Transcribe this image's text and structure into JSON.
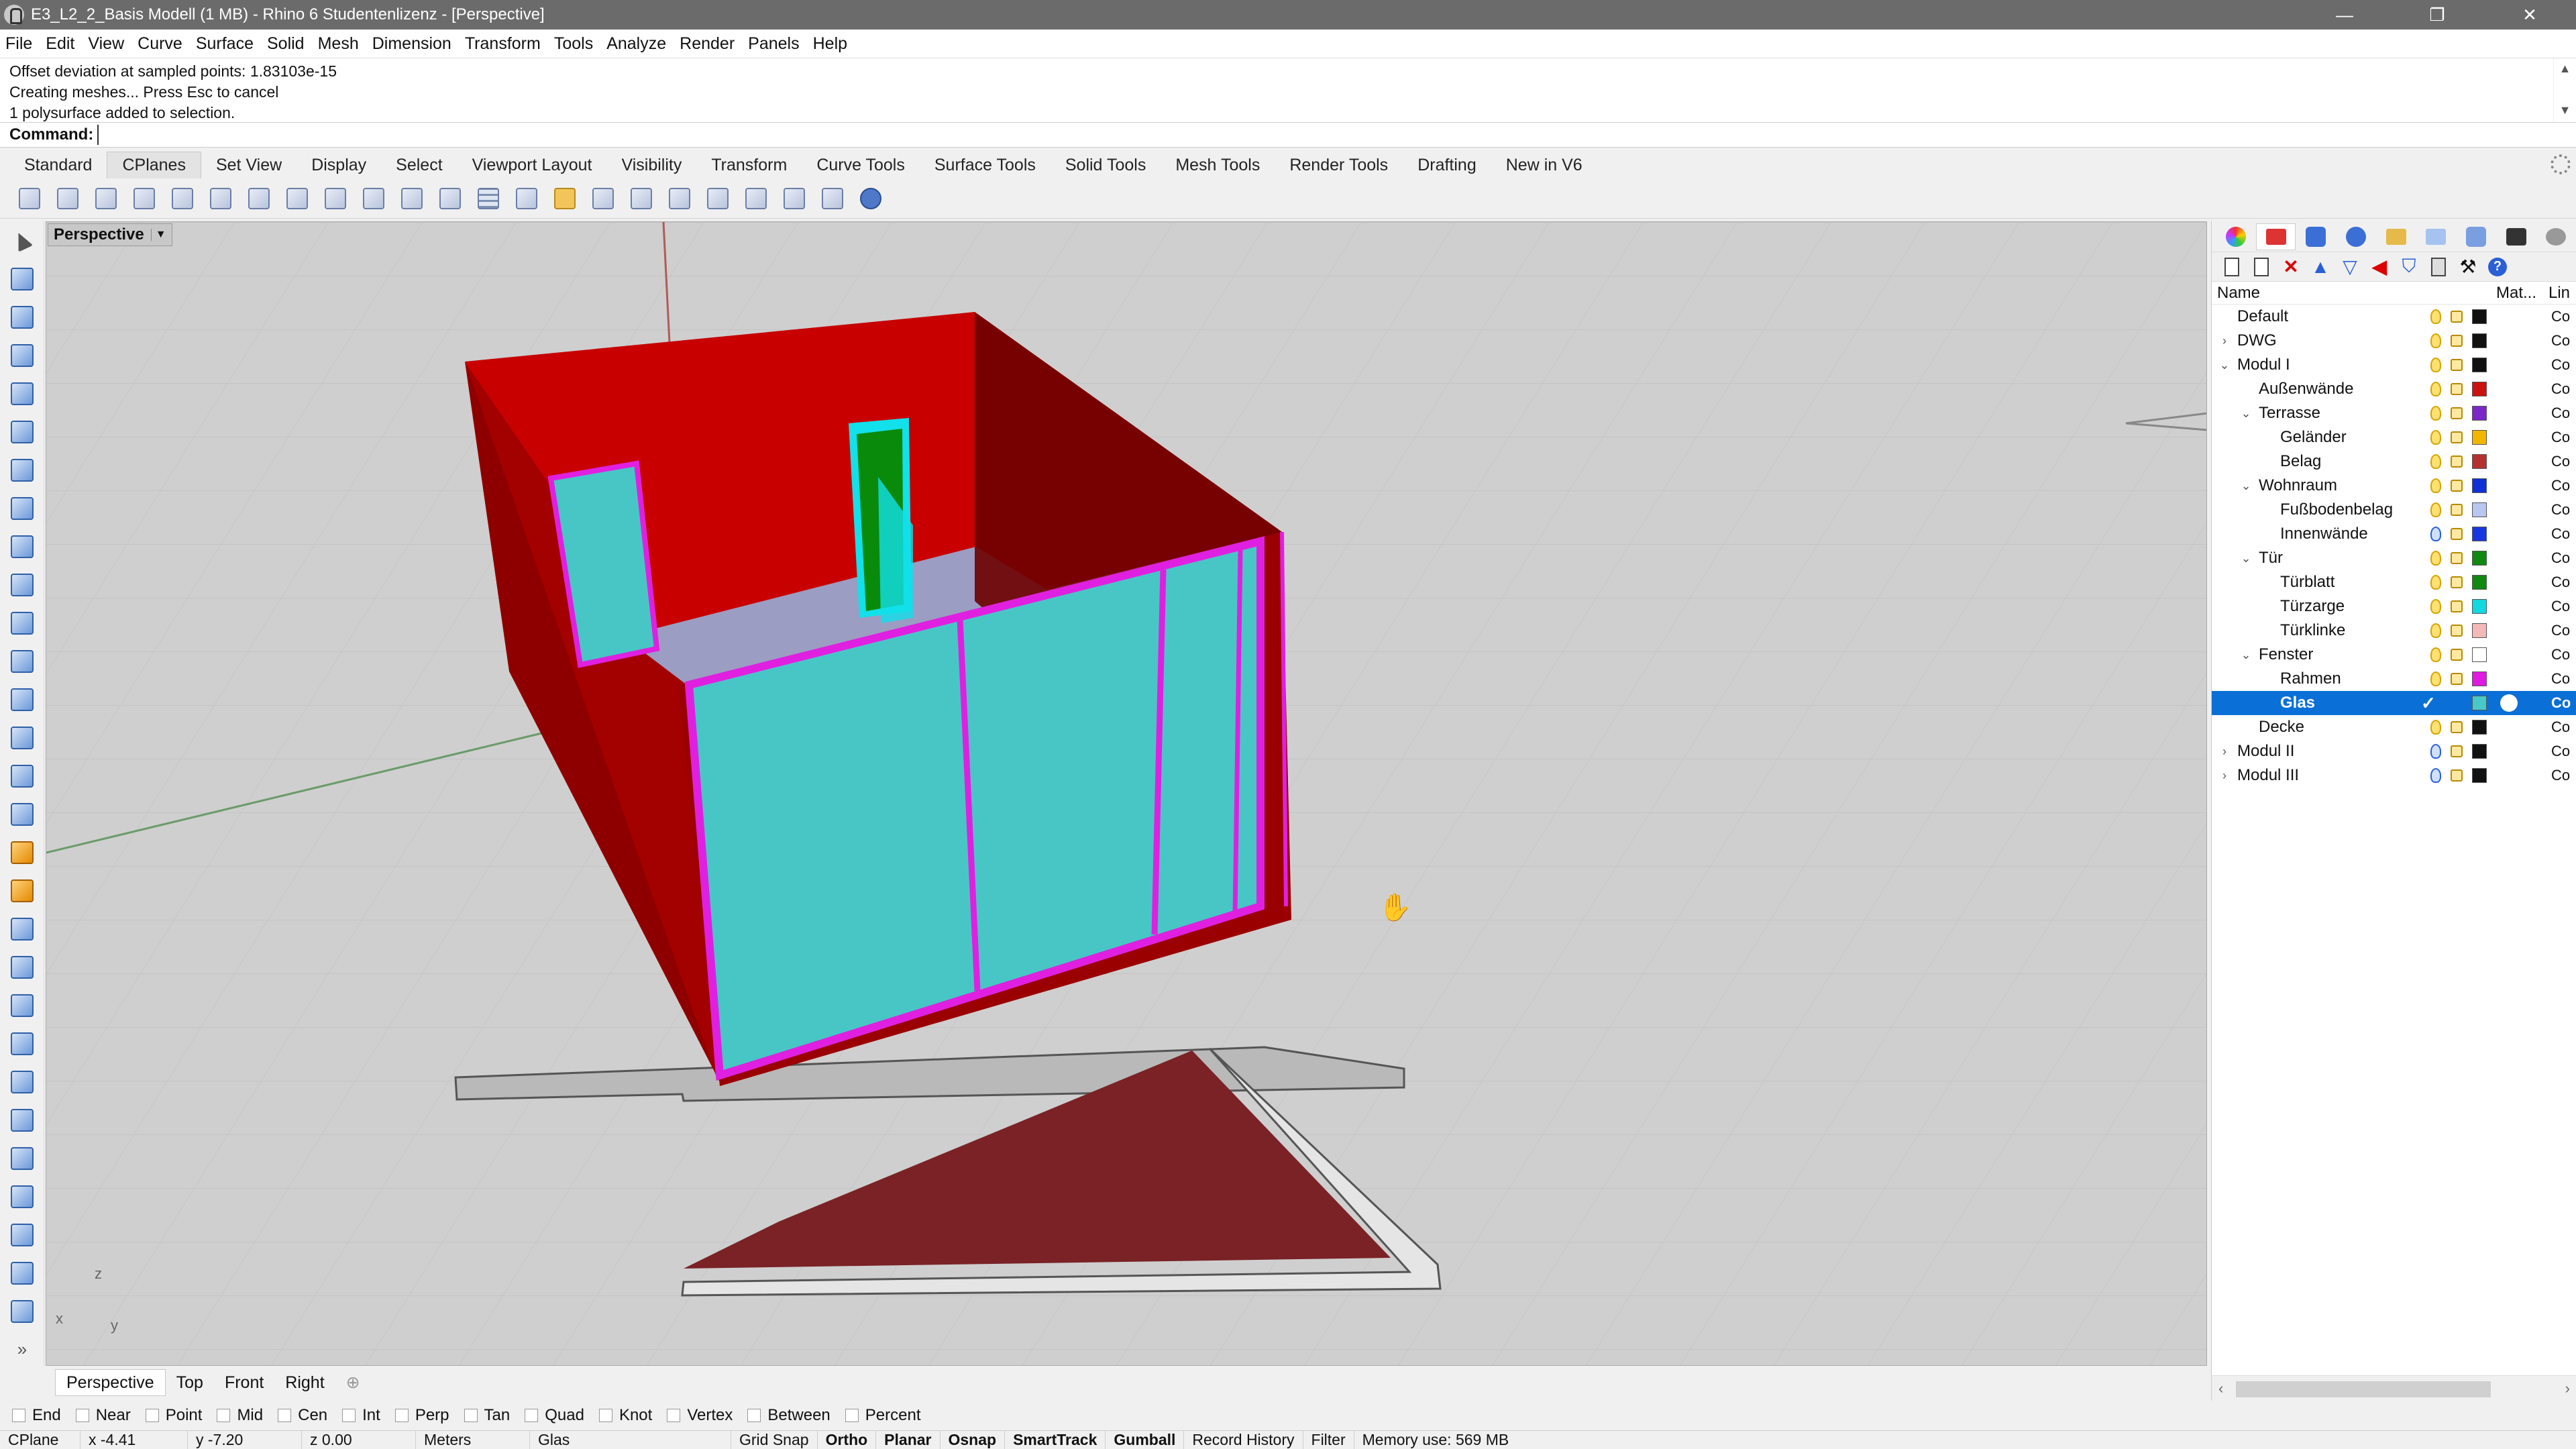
{
  "window": {
    "title": "E3_L2_2_Basis Modell (1 MB) - Rhino 6 Studentenlizenz - [Perspective]",
    "minimize": "—",
    "restore": "❐",
    "close": "✕"
  },
  "menu": [
    "File",
    "Edit",
    "View",
    "Curve",
    "Surface",
    "Solid",
    "Mesh",
    "Dimension",
    "Transform",
    "Tools",
    "Analyze",
    "Render",
    "Panels",
    "Help"
  ],
  "command_history": [
    "Offset deviation at sampled points: 1.83103e-15",
    "Creating meshes... Press Esc to cancel",
    "1 polysurface added to selection."
  ],
  "command": {
    "label": "Command:",
    "value": ""
  },
  "toolbar_tabs": [
    "Standard",
    "CPlanes",
    "Set View",
    "Display",
    "Select",
    "Viewport Layout",
    "Visibility",
    "Transform",
    "Curve Tools",
    "Surface Tools",
    "Solid Tools",
    "Mesh Tools",
    "Render Tools",
    "Drafting",
    "New in V6"
  ],
  "active_toolbar_tab": "CPlanes",
  "cplane_tools": [
    "cplane-world-top-icon",
    "cplane-world-front-icon",
    "cplane-world-right-icon",
    "cplane-origin-icon",
    "cplane-elevation-icon",
    "cplane-z-axis-icon",
    "cplane-3-point-icon",
    "cplane-x-axis-icon",
    "cplane-to-object-icon",
    "cplane-perpendicular-icon",
    "cplane-previous-icon",
    "cplane-next-icon",
    "grid-options-icon",
    "named-cplanes-icon",
    "open-cplane-icon",
    "set-cplane-view-icon",
    "cplane-to-curve-icon",
    "cplane-rotate-icon",
    "cplane-surface-icon",
    "cplane-3d-icon",
    "cplane-undo-icon",
    "cplane-redo-icon",
    "cplane-object-icon"
  ],
  "viewport": {
    "name": "Perspective",
    "axis_z": "z",
    "axis_x": "x",
    "axis_y": "y"
  },
  "viewport_tabs": [
    "Perspective",
    "Top",
    "Front",
    "Right"
  ],
  "osnaps": [
    "End",
    "Near",
    "Point",
    "Mid",
    "Cen",
    "Int",
    "Perp",
    "Tan",
    "Quad",
    "Knot",
    "Vertex",
    "Between",
    "Percent"
  ],
  "status": {
    "cplane": "CPlane",
    "x": "x -4.41",
    "y": "y -7.20",
    "z": "z 0.00",
    "units": "Meters",
    "layer": "Glas",
    "grid_snap": "Grid Snap",
    "ortho": "Ortho",
    "planar": "Planar",
    "osnap": "Osnap",
    "smarttrack": "SmartTrack",
    "gumball": "Gumball",
    "record_history": "Record History",
    "filter": "Filter",
    "memory": "Memory use: 569 MB"
  },
  "layers_panel": {
    "header_name": "Name",
    "header_material": "Mat...",
    "header_linetype": "Lin",
    "rows": [
      {
        "name": "Default",
        "indent": 0,
        "expander": "",
        "color": "#111111",
        "linetype": "Co",
        "bulb": "on"
      },
      {
        "name": "DWG",
        "indent": 0,
        "expander": "›",
        "color": "#111111",
        "linetype": "Co",
        "bulb": "on"
      },
      {
        "name": "Modul I",
        "indent": 0,
        "expander": "⌄",
        "color": "#111111",
        "linetype": "Co",
        "bulb": "on"
      },
      {
        "name": "Außenwände",
        "indent": 1,
        "expander": "",
        "color": "#cc1111",
        "linetype": "Co",
        "bulb": "on"
      },
      {
        "name": "Terrasse",
        "indent": 1,
        "expander": "⌄",
        "color": "#7a28c8",
        "linetype": "Co",
        "bulb": "on"
      },
      {
        "name": "Geländer",
        "indent": 2,
        "expander": "",
        "color": "#f2b600",
        "linetype": "Co",
        "bulb": "on"
      },
      {
        "name": "Belag",
        "indent": 2,
        "expander": "",
        "color": "#b53030",
        "linetype": "Co",
        "bulb": "on"
      },
      {
        "name": "Wohnraum",
        "indent": 1,
        "expander": "⌄",
        "color": "#1030d8",
        "linetype": "Co",
        "bulb": "on"
      },
      {
        "name": "Fußbodenbelag",
        "indent": 2,
        "expander": "",
        "color": "#b9c6f0",
        "linetype": "Co",
        "bulb": "on"
      },
      {
        "name": "Innenwände",
        "indent": 2,
        "expander": "",
        "color": "#1a36e0",
        "linetype": "Co",
        "bulb": "off"
      },
      {
        "name": "Tür",
        "indent": 1,
        "expander": "⌄",
        "color": "#118811",
        "linetype": "Co",
        "bulb": "on"
      },
      {
        "name": "Türblatt",
        "indent": 2,
        "expander": "",
        "color": "#118811",
        "linetype": "Co",
        "bulb": "on"
      },
      {
        "name": "Türzarge",
        "indent": 2,
        "expander": "",
        "color": "#12d8e0",
        "linetype": "Co",
        "bulb": "on"
      },
      {
        "name": "Türklinke",
        "indent": 2,
        "expander": "",
        "color": "#f2b9b9",
        "linetype": "Co",
        "bulb": "on"
      },
      {
        "name": "Fenster",
        "indent": 1,
        "expander": "⌄",
        "color": "#ffffff",
        "linetype": "Co",
        "bulb": "on"
      },
      {
        "name": "Rahmen",
        "indent": 2,
        "expander": "",
        "color": "#e01ae0",
        "linetype": "Co",
        "bulb": "on"
      },
      {
        "name": "Glas",
        "indent": 2,
        "expander": "",
        "color": "#48c8c8",
        "linetype": "Co",
        "bulb": "current",
        "selected": true
      },
      {
        "name": "Decke",
        "indent": 1,
        "expander": "",
        "color": "#111111",
        "linetype": "Co",
        "bulb": "on"
      },
      {
        "name": "Modul II",
        "indent": 0,
        "expander": "›",
        "color": "#111111",
        "linetype": "Co",
        "bulb": "off"
      },
      {
        "name": "Modul III",
        "indent": 0,
        "expander": "›",
        "color": "#111111",
        "linetype": "Co",
        "bulb": "off"
      }
    ]
  },
  "colors": {
    "walls_red": "#c00000",
    "walls_dark": "#7a0000",
    "frame_magenta": "#e020e0",
    "glass_cyan": "#48c6c6",
    "door_green": "#0a8a0a",
    "door_frame": "#12e0ea",
    "terrace_floor": "#7a2226",
    "viewport_bg": "#cfcfcf"
  }
}
